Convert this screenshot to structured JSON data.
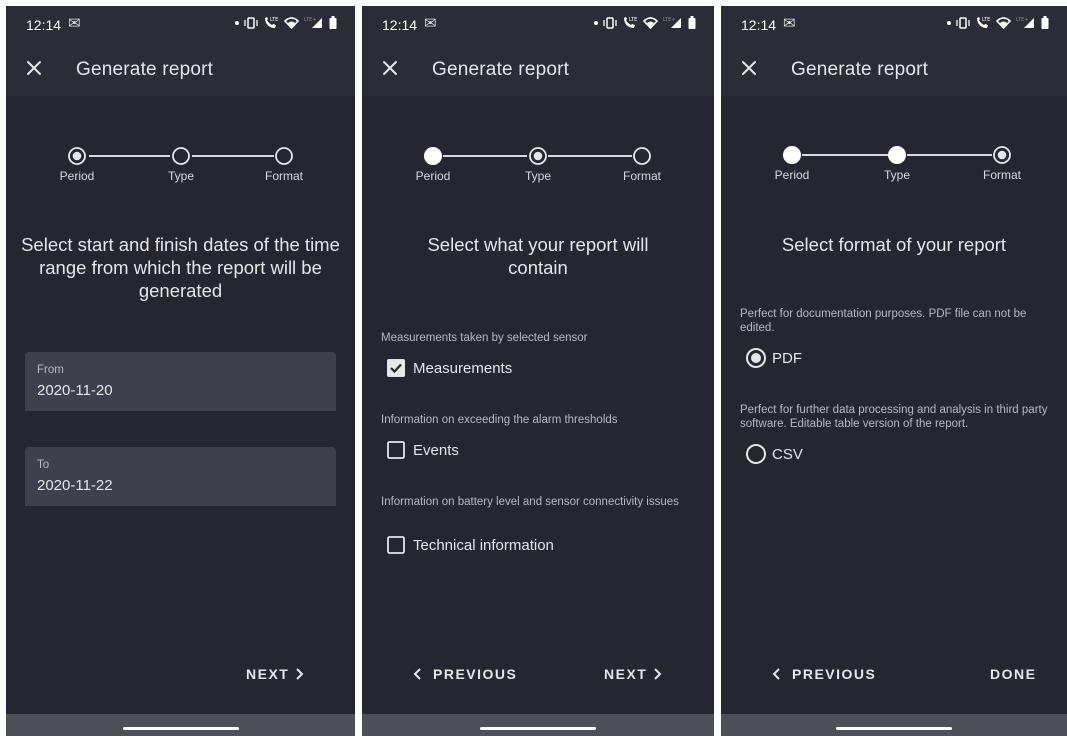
{
  "status": {
    "time": "12:14",
    "mail_icon": "gmail-icon"
  },
  "colors": {
    "background": "#25262f",
    "app_bar": "#2a2c36",
    "field_fill": "#3e404c",
    "text": "#e6e7eb",
    "secondary_text": "#b8bac2"
  },
  "app": {
    "title": "Generate report",
    "close_icon": "close-icon"
  },
  "steps": [
    {
      "label": "Period"
    },
    {
      "label": "Type"
    },
    {
      "label": "Format"
    }
  ],
  "screens": [
    {
      "step_states": [
        "current",
        "upcoming",
        "upcoming"
      ],
      "prompt": "Select start and finish dates of the time range from which the report will be generated",
      "fields": [
        {
          "label": "From",
          "value": "2020-11-20"
        },
        {
          "label": "To",
          "value": "2020-11-22"
        }
      ],
      "next_label": "NEXT"
    },
    {
      "step_states": [
        "done",
        "current",
        "upcoming"
      ],
      "prompt": "Select what your report will contain",
      "options": [
        {
          "description": "Measurements taken by selected sensor",
          "label": "Measurements",
          "checked": true
        },
        {
          "description": "Information on exceeding the alarm thresholds",
          "label": "Events",
          "checked": false
        },
        {
          "description": "Information on battery level and sensor connectivity issues",
          "label": "Technical information",
          "checked": false
        }
      ],
      "previous_label": "PREVIOUS",
      "next_label": "NEXT"
    },
    {
      "step_states": [
        "done",
        "done",
        "current"
      ],
      "prompt": "Select format of your report",
      "options": [
        {
          "description": "Perfect for documentation purposes. PDF file can not be edited.",
          "label": "PDF",
          "selected": true
        },
        {
          "description": "Perfect for further data processing and analysis in third party software. Editable table version of the report.",
          "label": "CSV",
          "selected": false
        }
      ],
      "previous_label": "PREVIOUS",
      "done_label": "DONE"
    }
  ]
}
